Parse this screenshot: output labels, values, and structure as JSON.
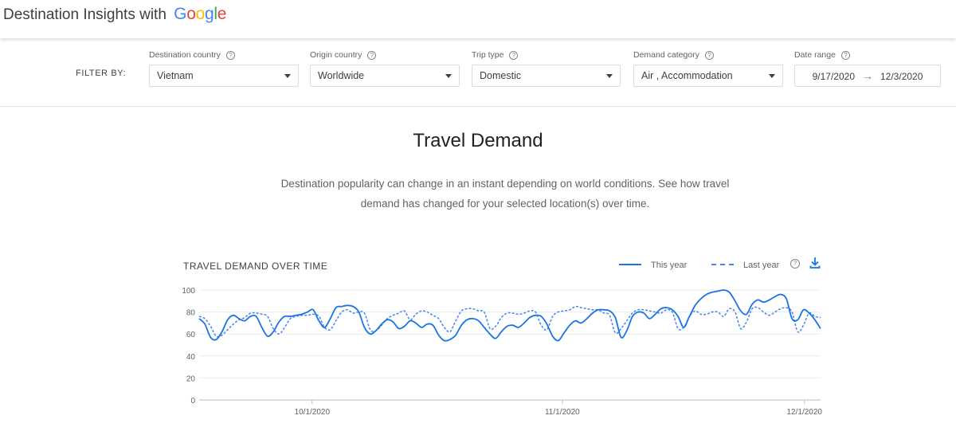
{
  "header": {
    "brand_prefix": "Destination Insights with",
    "brand_google": "Google",
    "google_colors": [
      "#4285f4",
      "#ea4335",
      "#fbbc05",
      "#4285f4",
      "#34a853",
      "#ea4335"
    ]
  },
  "filters": {
    "filter_by_label": "FILTER BY:",
    "destination_country": {
      "label": "Destination country",
      "value": "Vietnam"
    },
    "origin_country": {
      "label": "Origin country",
      "value": "Worldwide"
    },
    "trip_type": {
      "label": "Trip type",
      "value": "Domestic"
    },
    "demand_category": {
      "label": "Demand category",
      "value": "Air , Accommodation"
    },
    "date_range": {
      "label": "Date range",
      "start": "9/17/2020",
      "end": "12/3/2020"
    }
  },
  "main": {
    "title": "Travel Demand",
    "description_line1": "Destination popularity can change in an instant depending on world conditions. See how travel",
    "description_line2": "demand has changed for your selected location(s) over time."
  },
  "chart_data": {
    "type": "line",
    "title": "TRAVEL DEMAND OVER TIME",
    "x_start": "9/17/2020",
    "x_end": "12/3/2020",
    "x_ticks": [
      {
        "date": "10/1/2020",
        "label": "10/1/2020"
      },
      {
        "date": "11/1/2020",
        "label": "11/1/2020"
      },
      {
        "date": "12/1/2020",
        "label": "12/1/2020"
      }
    ],
    "ylim": [
      0,
      100
    ],
    "y_ticks": [
      0,
      20,
      40,
      60,
      80,
      100
    ],
    "grid": true,
    "legend_position": "top-right",
    "colors": {
      "this_year": "#1a73e8",
      "last_year": "#4285f4"
    },
    "series": [
      {
        "name": "This year",
        "style": "solid",
        "values": [
          74,
          69,
          57,
          55,
          62,
          73,
          77,
          74,
          72,
          76,
          76,
          66,
          58,
          62,
          71,
          76,
          76,
          77,
          78,
          80,
          82,
          72,
          66,
          74,
          84,
          85,
          86,
          85,
          80,
          66,
          60,
          63,
          69,
          73,
          71,
          65,
          67,
          72,
          70,
          66,
          69,
          68,
          59,
          54,
          55,
          59,
          68,
          73,
          74,
          72,
          66,
          60,
          56,
          62,
          67,
          68,
          66,
          70,
          75,
          77,
          76,
          69,
          58,
          54,
          61,
          68,
          72,
          70,
          74,
          79,
          82,
          82,
          81,
          75,
          57,
          63,
          76,
          80,
          79,
          74,
          78,
          83,
          84,
          82,
          76,
          66,
          76,
          86,
          92,
          96,
          98,
          99,
          100,
          98,
          90,
          81,
          78,
          87,
          91,
          89,
          91,
          94,
          96,
          92,
          74,
          73,
          82,
          79,
          73,
          65
        ]
      },
      {
        "name": "Last year",
        "style": "dashed",
        "values": [
          76,
          74,
          67,
          58,
          59,
          64,
          69,
          73,
          75,
          79,
          79,
          78,
          76,
          65,
          60,
          66,
          74,
          76,
          77,
          77,
          78,
          76,
          66,
          64,
          72,
          80,
          82,
          79,
          80,
          79,
          64,
          63,
          68,
          74,
          77,
          79,
          81,
          73,
          78,
          81,
          80,
          77,
          74,
          66,
          62,
          72,
          81,
          83,
          83,
          81,
          80,
          65,
          67,
          75,
          79,
          79,
          78,
          79,
          81,
          80,
          68,
          64,
          76,
          80,
          81,
          82,
          85,
          84,
          83,
          82,
          82,
          79,
          77,
          61,
          65,
          72,
          79,
          82,
          82,
          81,
          80,
          79,
          82,
          80,
          65,
          66,
          76,
          81,
          78,
          78,
          80,
          80,
          76,
          83,
          80,
          65,
          71,
          83,
          84,
          80,
          77,
          80,
          83,
          84,
          80,
          62,
          68,
          79,
          76,
          75
        ]
      }
    ]
  }
}
